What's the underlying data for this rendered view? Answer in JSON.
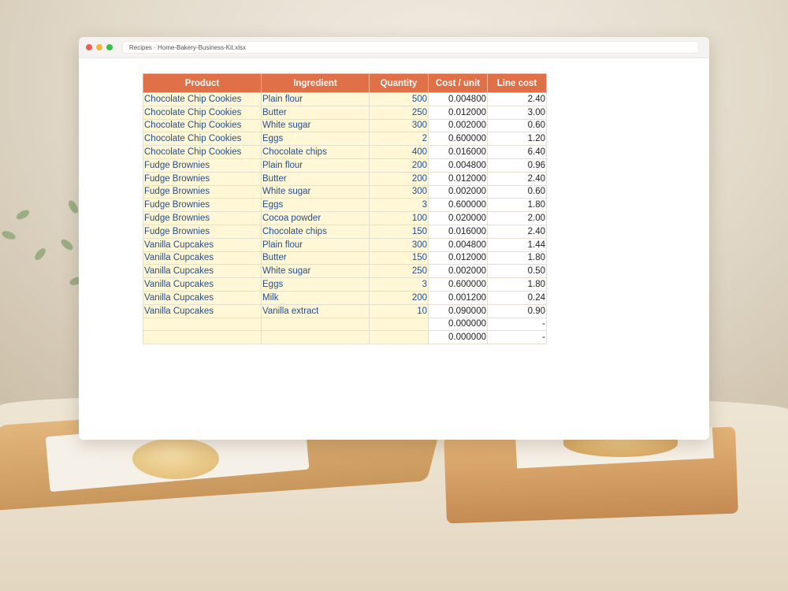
{
  "window": {
    "breadcrumb": "Recipes · Home-Bakery-Business-Kit.xlsx"
  },
  "table": {
    "headers": [
      "Product",
      "Ingredient",
      "Quantity",
      "Cost / unit",
      "Line cost"
    ],
    "rows": [
      {
        "product": "Chocolate Chip Cookies",
        "ingredient": "Plain flour",
        "quantity": "500",
        "cost_unit": "0.004800",
        "line_cost": "2.40"
      },
      {
        "product": "Chocolate Chip Cookies",
        "ingredient": "Butter",
        "quantity": "250",
        "cost_unit": "0.012000",
        "line_cost": "3.00"
      },
      {
        "product": "Chocolate Chip Cookies",
        "ingredient": "White sugar",
        "quantity": "300",
        "cost_unit": "0.002000",
        "line_cost": "0.60"
      },
      {
        "product": "Chocolate Chip Cookies",
        "ingredient": "Eggs",
        "quantity": "2",
        "cost_unit": "0.600000",
        "line_cost": "1.20"
      },
      {
        "product": "Chocolate Chip Cookies",
        "ingredient": "Chocolate chips",
        "quantity": "400",
        "cost_unit": "0.016000",
        "line_cost": "6.40"
      },
      {
        "product": "Fudge Brownies",
        "ingredient": "Plain flour",
        "quantity": "200",
        "cost_unit": "0.004800",
        "line_cost": "0.96"
      },
      {
        "product": "Fudge Brownies",
        "ingredient": "Butter",
        "quantity": "200",
        "cost_unit": "0.012000",
        "line_cost": "2.40"
      },
      {
        "product": "Fudge Brownies",
        "ingredient": "White sugar",
        "quantity": "300",
        "cost_unit": "0.002000",
        "line_cost": "0.60"
      },
      {
        "product": "Fudge Brownies",
        "ingredient": "Eggs",
        "quantity": "3",
        "cost_unit": "0.600000",
        "line_cost": "1.80"
      },
      {
        "product": "Fudge Brownies",
        "ingredient": "Cocoa powder",
        "quantity": "100",
        "cost_unit": "0.020000",
        "line_cost": "2.00"
      },
      {
        "product": "Fudge Brownies",
        "ingredient": "Chocolate chips",
        "quantity": "150",
        "cost_unit": "0.016000",
        "line_cost": "2.40"
      },
      {
        "product": "Vanilla Cupcakes",
        "ingredient": "Plain flour",
        "quantity": "300",
        "cost_unit": "0.004800",
        "line_cost": "1.44"
      },
      {
        "product": "Vanilla Cupcakes",
        "ingredient": "Butter",
        "quantity": "150",
        "cost_unit": "0.012000",
        "line_cost": "1.80"
      },
      {
        "product": "Vanilla Cupcakes",
        "ingredient": "White sugar",
        "quantity": "250",
        "cost_unit": "0.002000",
        "line_cost": "0.50"
      },
      {
        "product": "Vanilla Cupcakes",
        "ingredient": "Eggs",
        "quantity": "3",
        "cost_unit": "0.600000",
        "line_cost": "1.80"
      },
      {
        "product": "Vanilla Cupcakes",
        "ingredient": "Milk",
        "quantity": "200",
        "cost_unit": "0.001200",
        "line_cost": "0.24"
      },
      {
        "product": "Vanilla Cupcakes",
        "ingredient": "Vanilla extract",
        "quantity": "10",
        "cost_unit": "0.090000",
        "line_cost": "0.90"
      },
      {
        "product": "",
        "ingredient": "",
        "quantity": "",
        "cost_unit": "0.000000",
        "line_cost": "-"
      },
      {
        "product": "",
        "ingredient": "",
        "quantity": "",
        "cost_unit": "0.000000",
        "line_cost": "-"
      }
    ]
  },
  "colors": {
    "header_bg": "#e07048",
    "input_cell_bg": "#fff7d6",
    "input_text": "#254f8f",
    "window_dot_red": "#ee5e56",
    "window_dot_yellow": "#f3b63d",
    "window_dot_green": "#35c049"
  }
}
